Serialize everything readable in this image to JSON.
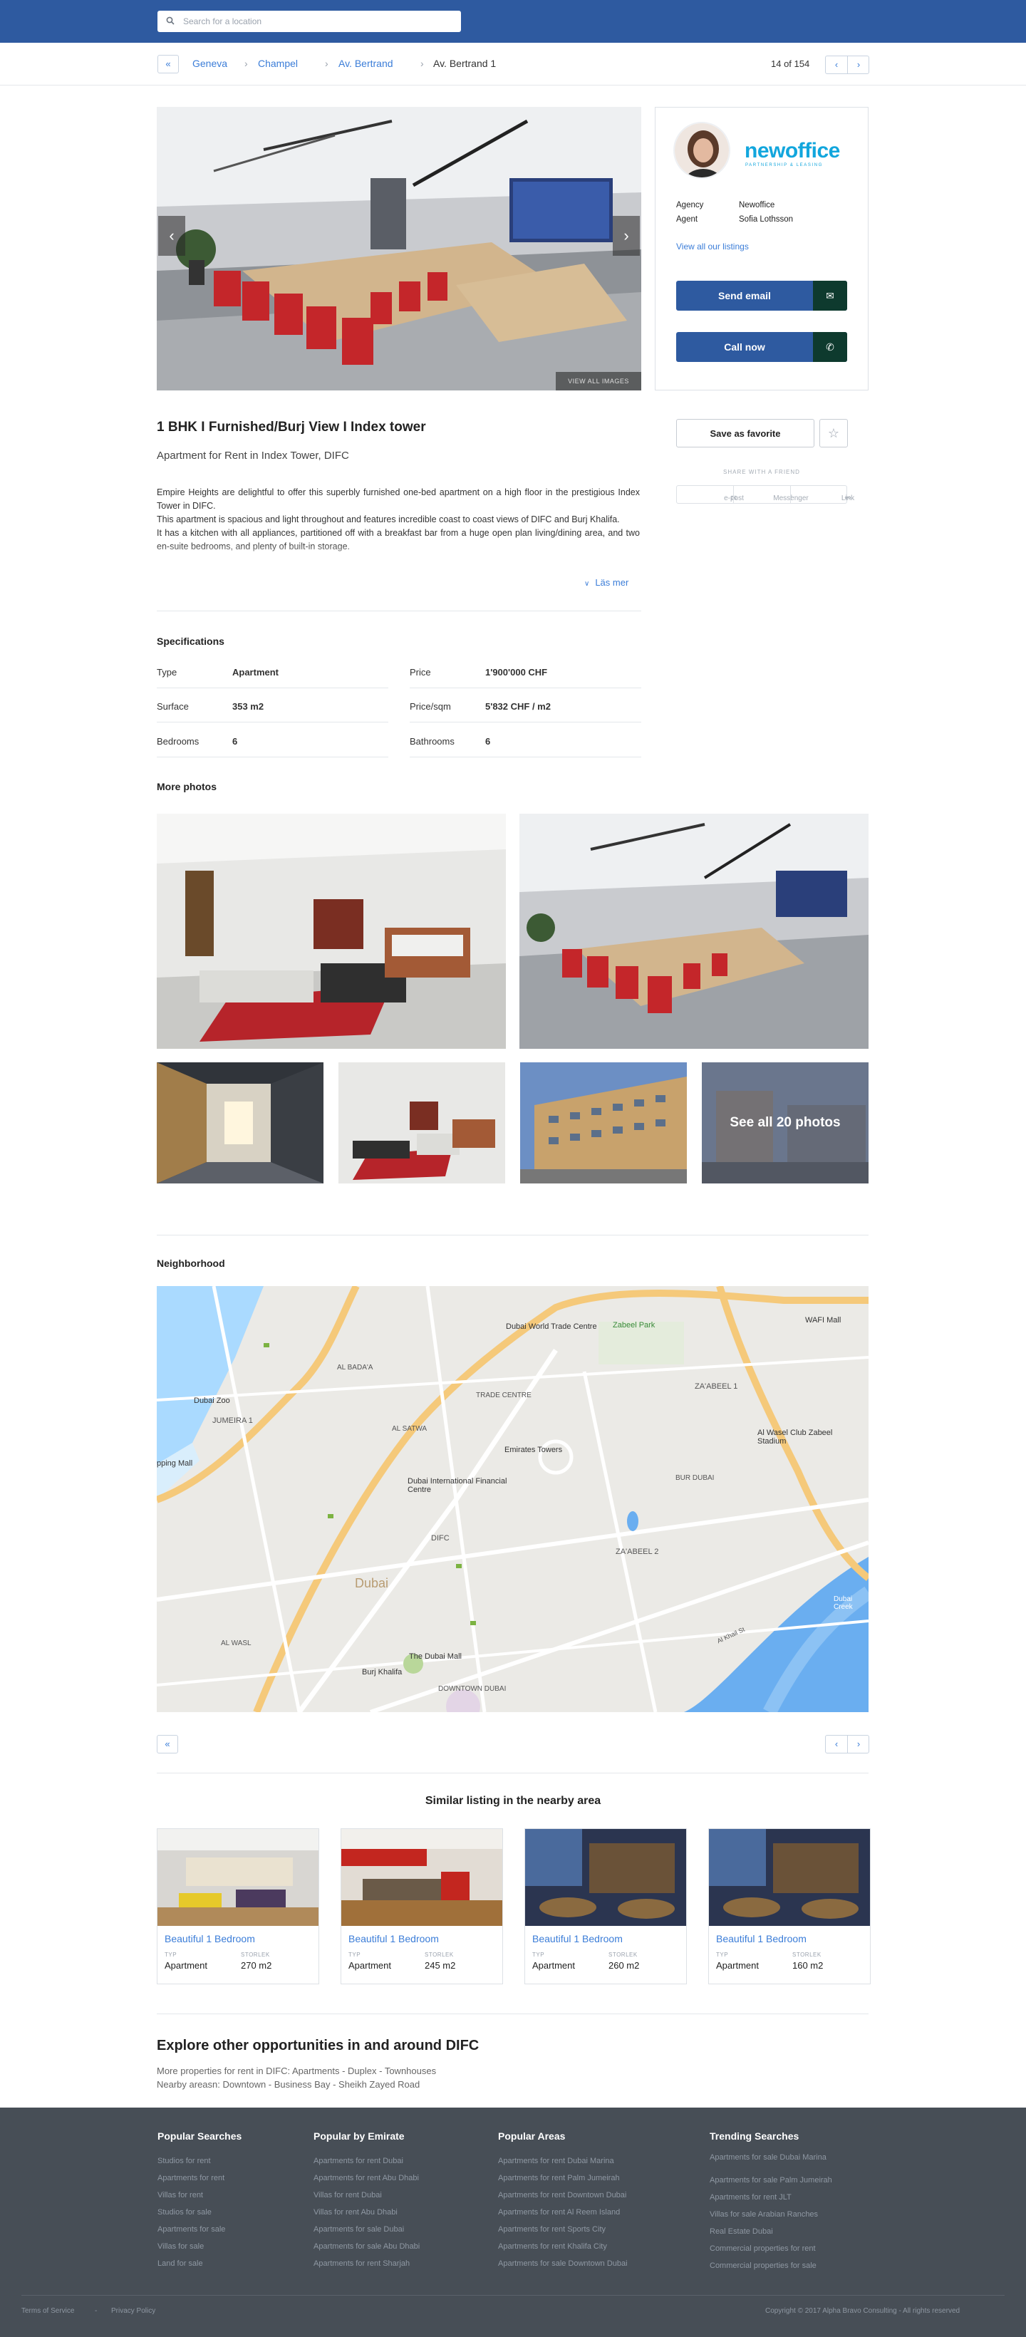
{
  "search": {
    "placeholder": "Search for a location"
  },
  "breadcrumb": {
    "back": "«",
    "items": [
      "Geneva",
      "Champel",
      "Av. Bertrand",
      "Av. Bertrand 1"
    ],
    "counter": "14 of 154",
    "prev": "‹",
    "next": "›"
  },
  "gallery": {
    "view_all": "VIEW ALL IMAGES",
    "prev": "‹",
    "next": "›"
  },
  "agent": {
    "brand": "newoffice",
    "brand_sub": "PARTNERSHIP & LEASING",
    "agency_label": "Agency",
    "agency": "Newoffice",
    "agent_label": "Agent",
    "agent": "Sofia Lothsson",
    "listings_link": "View all our listings",
    "email_button": "Send email",
    "call_button": "Call now"
  },
  "listing": {
    "title": "1 BHK I Furnished/Burj View I Index tower",
    "subtitle": "Apartment for Rent in Index Tower, DIFC",
    "description": [
      "Empire Heights are delightful to offer this superbly furnished one-bed apartment on a high floor in the prestigious Index Tower in DIFC.",
      "This apartment is spacious and light throughout and features incredible coast to coast views of DIFC and Burj Khalifa.",
      "It has a kitchen with all appliances, partitioned off with a breakfast bar from a huge open plan living/dining area, and two en-suite bedrooms, and plenty of built-in storage."
    ],
    "read_more": "Läs mer"
  },
  "actions": {
    "favorite": "Save as favorite",
    "share_label": "SHARE WITH A FRIEND",
    "share": [
      "e-post",
      "Messenger",
      "Link"
    ]
  },
  "specs": {
    "heading": "Specifications",
    "rows": [
      {
        "label": "Type",
        "value": "Apartment",
        "label2": "Price",
        "value2": "1'900'000 CHF"
      },
      {
        "label": "Surface",
        "value": "353 m2",
        "label2": "Price/sqm",
        "value2": "5'832 CHF / m2"
      },
      {
        "label": "Bedrooms",
        "value": "6",
        "label2": "Bathrooms",
        "value2": "6"
      }
    ]
  },
  "photos": {
    "heading": "More photos",
    "see_all": "See all 20 photos"
  },
  "neighborhood": {
    "heading": "Neighborhood",
    "prev": "‹",
    "next": "›",
    "back": "«",
    "labels": [
      "Dubai World Trade Centre",
      "Zabeel Park",
      "WAFI Mall",
      "AL BADA'A",
      "TRADE CENTRE",
      "ZA'ABEEL 1",
      "Dubai Zoo",
      "JUMEIRA 1",
      "AL SATWA",
      "Emirates Towers",
      "Al Wasel Club Zabeel Stadium",
      "pping Mall",
      "BUR DUBAI",
      "Dubai International Financial Centre",
      "DIFC",
      "ZA'ABEEL 2",
      "Dubai",
      "AL WASL",
      "The Dubai Mall",
      "Burj Khalifa",
      "DOWNTOWN DUBAI",
      "Dubai Creek",
      "Al Khail St"
    ]
  },
  "similar": {
    "heading": "Similar listing in the nearby area",
    "type_label": "TYP",
    "size_label": "STORLEK",
    "cards": [
      {
        "title": "Beautiful 1 Bedroom",
        "type": "Apartment",
        "size": "270 m2"
      },
      {
        "title": "Beautiful 1 Bedroom",
        "type": "Apartment",
        "size": "245 m2"
      },
      {
        "title": "Beautiful 1 Bedroom",
        "type": "Apartment",
        "size": "260 m2"
      },
      {
        "title": "Beautiful 1 Bedroom",
        "type": "Apartment",
        "size": "160 m2"
      }
    ]
  },
  "explore": {
    "heading": "Explore other opportunities in and around DIFC",
    "line1": "More properties for rent in DIFC: Apartments - Duplex - Townhouses",
    "line2": "Nearby areasn: Downtown - Business Bay - Sheikh Zayed Road"
  },
  "footer": {
    "cols": [
      {
        "title": "Popular Searches",
        "items": [
          "Studios for rent",
          "Apartments for rent",
          "Villas for rent",
          "Studios for sale",
          "Apartments for sale",
          "Villas for sale",
          "Land for sale"
        ]
      },
      {
        "title": "Popular by Emirate",
        "items": [
          "Apartments for rent Dubai",
          "Apartments for rent Abu Dhabi",
          "Villas for rent Dubai",
          "Villas for rent Abu Dhabi",
          "Apartments for sale Dubai",
          "Apartments for sale Abu Dhabi",
          "Apartments for rent Sharjah"
        ]
      },
      {
        "title": "Popular Areas",
        "items": [
          "Apartments for rent Dubai Marina",
          "Apartments for rent Palm Jumeirah",
          "Apartments for rent Downtown Dubai",
          "Apartments for rent Al Reem Island",
          "Apartments for rent Sports City",
          "Apartments for rent Khalifa City",
          "Apartments for sale Downtown Dubai"
        ]
      },
      {
        "title": "Trending Searches",
        "items": [
          "Apartments for sale Dubai Marina",
          "Apartments for sale Palm Jumeirah",
          "Apartments for rent JLT",
          "Villas for sale Arabian Ranches",
          "Real Estate Dubai",
          "Commercial properties for rent",
          "Commercial properties for sale"
        ]
      }
    ],
    "terms": "Terms of Service",
    "dash": "-",
    "privacy": "Privacy Policy",
    "copyright": "Copyright © 2017 Alpha Bravo Consulting - All rights reserved"
  },
  "colors": {
    "header": "#2e5aa0",
    "link": "#3b7dd8",
    "footer": "#474e56",
    "brand": "#12a6dd"
  }
}
